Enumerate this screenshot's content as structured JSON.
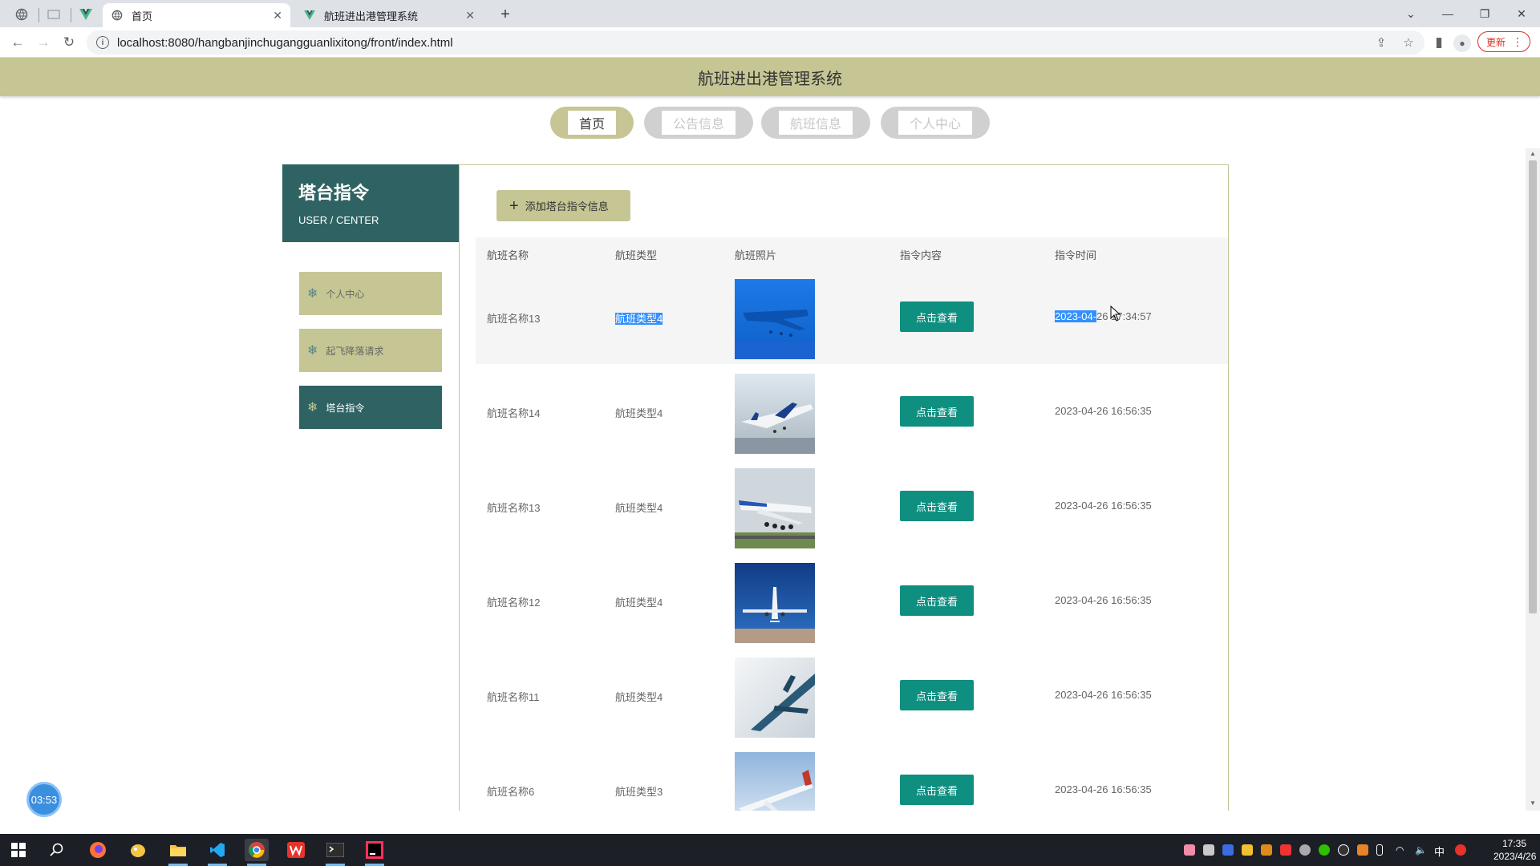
{
  "browser": {
    "tabs": [
      {
        "title": "首页",
        "active": true
      },
      {
        "title": "航班进出港管理系统",
        "active": false
      }
    ],
    "url": "localhost:8080/hangbanjinchugangguanlixitong/front/index.html",
    "update_label": "更新"
  },
  "site": {
    "title": "航班进出港管理系统",
    "nav": [
      {
        "label": "首页",
        "active": true
      },
      {
        "label": "公告信息",
        "active": false
      },
      {
        "label": "航班信息",
        "active": false
      },
      {
        "label": "个人中心",
        "active": false
      }
    ]
  },
  "sidebar": {
    "title": "塔台指令",
    "subtitle": "USER / CENTER",
    "items": [
      {
        "label": "个人中心",
        "active": false
      },
      {
        "label": "起飞降落请求",
        "active": false
      },
      {
        "label": "塔台指令",
        "active": true
      }
    ]
  },
  "content": {
    "add_button": "添加塔台指令信息",
    "columns": [
      "航班名称",
      "航班类型",
      "航班照片",
      "指令内容",
      "指令时间"
    ],
    "view_label": "点击查看",
    "rows": [
      {
        "name": "航班名称13",
        "type": "航班类型4",
        "time_selected": "2023-04-",
        "time_rest": "26 17:34:57"
      },
      {
        "name": "航班名称14",
        "type": "航班类型4",
        "time": "2023-04-26 16:56:35"
      },
      {
        "name": "航班名称13",
        "type": "航班类型4",
        "time": "2023-04-26 16:56:35"
      },
      {
        "name": "航班名称12",
        "type": "航班类型4",
        "time": "2023-04-26 16:56:35"
      },
      {
        "name": "航班名称11",
        "type": "航班类型4",
        "time": "2023-04-26 16:56:35"
      },
      {
        "name": "航班名称6",
        "type": "航班类型3",
        "time": "2023-04-26 16:56:35"
      }
    ]
  },
  "timer": "03:53",
  "taskbar": {
    "ime": "中",
    "time": "17:35",
    "date": "2023/4/26"
  },
  "colors": {
    "olive": "#c5c694",
    "teal_dark": "#2f6363",
    "button_teal": "#0e8f80"
  }
}
